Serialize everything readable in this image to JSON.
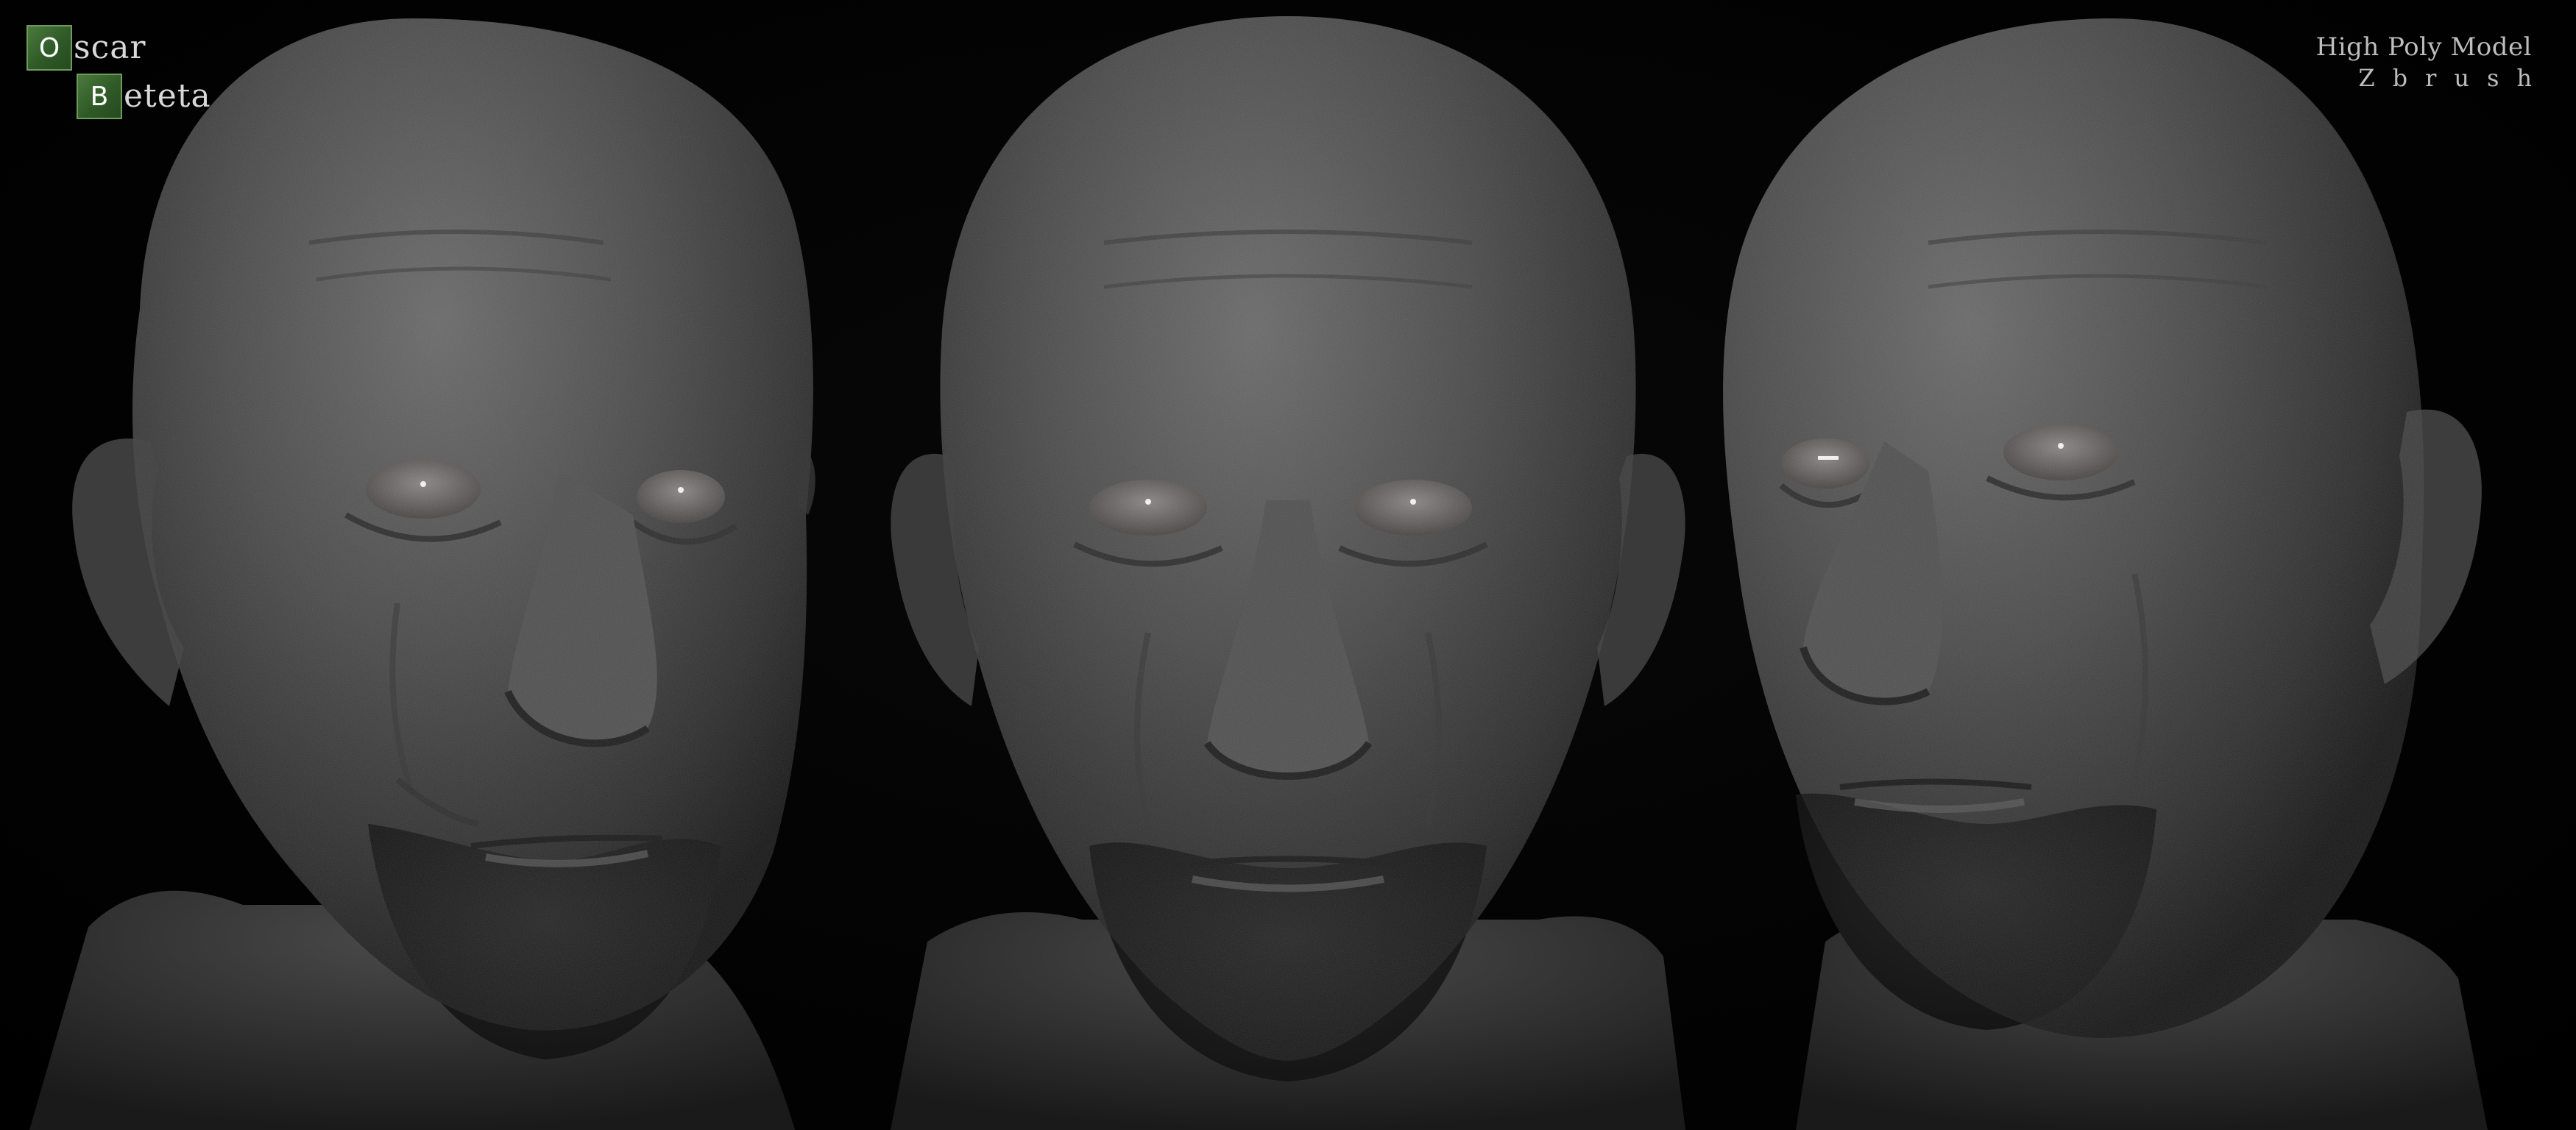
{
  "logo": {
    "row1": {
      "symbol": "O",
      "rest": "scar"
    },
    "row2": {
      "symbol": "B",
      "rest": "eteta"
    },
    "accent_color": "#3f6f33"
  },
  "caption": {
    "line1": "High Poly Model",
    "line2": "Zbrush"
  },
  "views": [
    {
      "name": "three-quarter-left"
    },
    {
      "name": "front"
    },
    {
      "name": "three-quarter-right"
    }
  ]
}
